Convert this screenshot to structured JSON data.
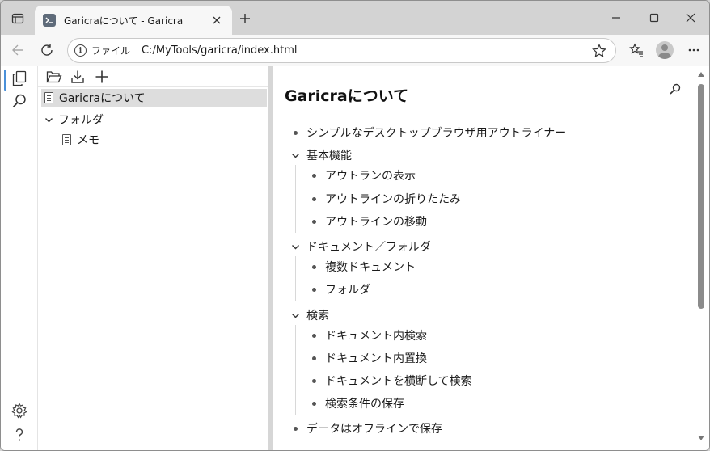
{
  "browser": {
    "tab_title": "Garicraについて - Garicra",
    "url_scheme_label": "ファイル",
    "url": "C:/MyTools/garicra/index.html"
  },
  "sidebar": {
    "documents": [
      {
        "label": "Garicraについて",
        "selected": true
      }
    ],
    "folders": [
      {
        "label": "フォルダ",
        "expanded": true,
        "children": [
          {
            "label": "メモ"
          }
        ]
      }
    ]
  },
  "document": {
    "title": "Garicraについて",
    "outline": [
      {
        "text": "シンプルなデスクトップブラウザ用アウトライナー"
      },
      {
        "text": "基本機能",
        "children": [
          "アウトランの表示",
          "アウトラインの折りたたみ",
          "アウトラインの移動"
        ]
      },
      {
        "text": "ドキュメント／フォルダ",
        "children": [
          "複数ドキュメント",
          "フォルダ"
        ]
      },
      {
        "text": "検索",
        "children": [
          "ドキュメント内検索",
          "ドキュメント内置換",
          "ドキュメントを横断して検索",
          "検索条件の保存"
        ]
      },
      {
        "text": "データはオフラインで保存"
      }
    ]
  },
  "colors": {
    "accent": "#4a90d9",
    "selected_row": "#dddddd",
    "chrome_bg": "#d3d3d3"
  },
  "icons": {
    "activity": [
      "documents-icon",
      "search-icon",
      "settings-icon",
      "help-icon"
    ],
    "sidebar_tools": [
      "open-folder-icon",
      "download-icon",
      "add-icon"
    ]
  }
}
